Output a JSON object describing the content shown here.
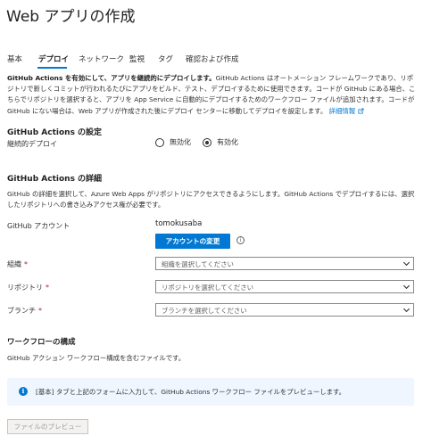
{
  "page": {
    "title": "Web アプリの作成",
    "more_icon": "ellipsis-icon"
  },
  "tabs": [
    {
      "label": "基本",
      "active": false
    },
    {
      "label": "デプロイ",
      "active": true
    },
    {
      "label": "ネットワーク",
      "active": false
    },
    {
      "label": "監視",
      "active": false
    },
    {
      "label": "タグ",
      "active": false
    },
    {
      "label": "確認および作成",
      "active": false
    }
  ],
  "intro": {
    "bold": "GitHub Actions を有効にして、アプリを継続的にデプロイします。",
    "text": "GitHub Actions はオートメーション フレームワークであり、リポジトリで新しくコミットが行われるたびにアプリをビルド、テスト、デプロイするために使用できます。コードが GitHub にある場合、こちらでリポジトリを選択すると、アプリを App Service に自動的にデプロイするためのワークフロー ファイルが追加されます。コードが GitHub にない場合は、Web アプリが作成された後にデプロイ センターに移動してデプロイを設定します。",
    "link": "詳細情報",
    "link_icon": "external-link-icon"
  },
  "settings": {
    "title": "GitHub Actions の設定",
    "cd_label": "継続的デプロイ",
    "options": [
      {
        "label": "無効化",
        "checked": false
      },
      {
        "label": "有効化",
        "checked": true
      }
    ]
  },
  "details": {
    "title": "GitHub Actions の詳細",
    "text": "GitHub の詳細を選択して、Azure Web Apps がリポジトリにアクセスできるようにします。GitHub Actions でデプロイするには、選択したリポジトリへの書き込みアクセス権が必要です。",
    "account_label": "GitHub アカウント",
    "account_value": "tomokusaba",
    "change_button": "アカウントの変更",
    "info_icon": "info-icon"
  },
  "fields": [
    {
      "label": "組織",
      "required": "*",
      "placeholder": "組織を選択してください"
    },
    {
      "label": "リポジトリ",
      "required": "*",
      "placeholder": "リポジトリを選択してください"
    },
    {
      "label": "ブランチ",
      "required": "*",
      "placeholder": "ブランチを選択してください"
    }
  ],
  "workflow": {
    "title": "ワークフローの構成",
    "text": "GitHub アクション ワークフロー構成を含むファイルです。"
  },
  "info_bar": {
    "icon": "info-icon",
    "text": "[基本] タブと上記のフォームに入力して、GitHub Actions ワークフロー ファイルをプレビューします。"
  },
  "preview_button": "ファイルのプレビュー",
  "colors": {
    "accent": "#0078d4",
    "required": "#a4262c",
    "info_bg": "#f0f6ff"
  }
}
